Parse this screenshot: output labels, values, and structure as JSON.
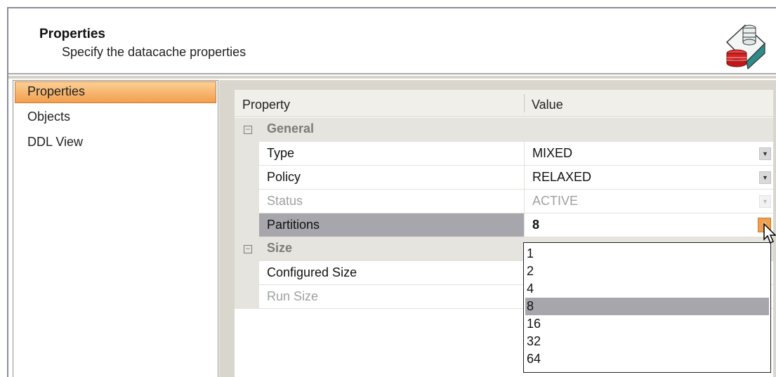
{
  "header": {
    "title": "Properties",
    "subtitle": "Specify the datacache properties"
  },
  "nav": {
    "items": [
      {
        "label": "Properties",
        "selected": true
      },
      {
        "label": "Objects",
        "selected": false
      },
      {
        "label": "DDL View",
        "selected": false
      }
    ]
  },
  "grid": {
    "columns": {
      "property": "Property",
      "value": "Value"
    },
    "categories": {
      "general": {
        "label": "General",
        "collapse_symbol": "⊟"
      },
      "size": {
        "label": "Size",
        "collapse_symbol": "⊟"
      }
    },
    "rows": {
      "type": {
        "name": "Type",
        "value": "MIXED"
      },
      "policy": {
        "name": "Policy",
        "value": "RELAXED"
      },
      "status": {
        "name": "Status",
        "value": "ACTIVE"
      },
      "partitions": {
        "name": "Partitions",
        "value": "8"
      },
      "configured_size": {
        "name": "Configured Size",
        "value": ""
      },
      "run_size": {
        "name": "Run Size",
        "value": ""
      }
    }
  },
  "partitions_dropdown": {
    "options": [
      "1",
      "2",
      "4",
      "8",
      "16",
      "32",
      "64"
    ],
    "selected": "8"
  },
  "icons": {
    "header_icon": "datacache-database-icon",
    "dropdown_arrow": "chevron-down-icon"
  },
  "colors": {
    "nav_selected": "#f29f4d",
    "selected_row": "#a7a6ac",
    "panel_bg": "#d8d6cd"
  }
}
